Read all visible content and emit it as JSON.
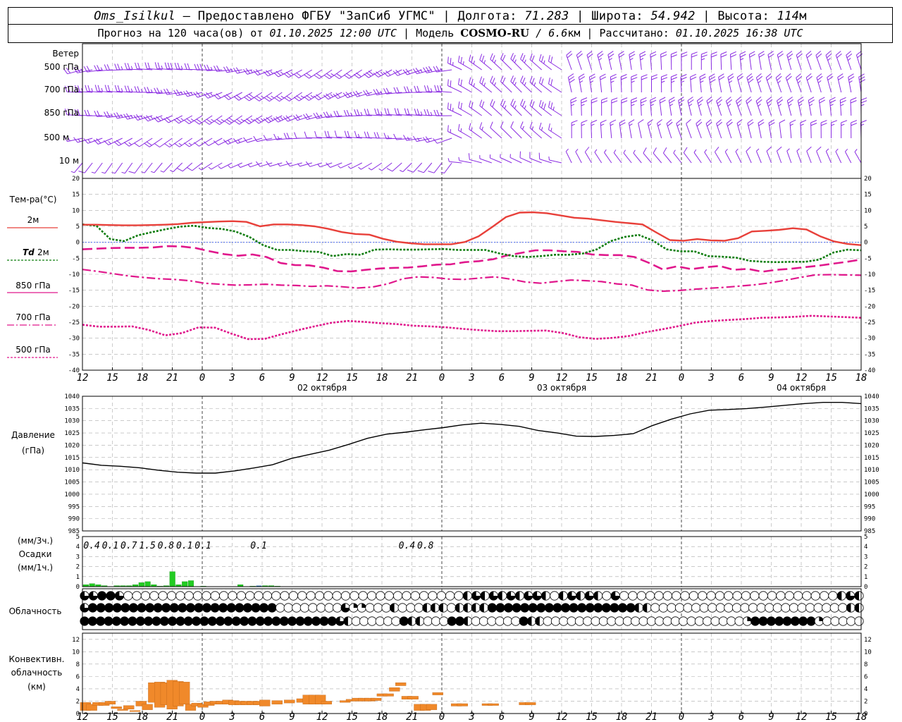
{
  "header": {
    "station": "Oms_Isilkul",
    "dash": "–",
    "provider": "Предоставлено ФГБУ \"ЗапСиб УГМС\"",
    "lon_label": "Долгота:",
    "lon": "71.283",
    "lat_label": "Широта:",
    "lat": "54.942",
    "alt_label": "Высота:",
    "alt": "114",
    "alt_unit": "м",
    "sep": "|",
    "forecast_prefix": "Прогноз на 120 часа(ов)",
    "from_word": "от",
    "forecast_time": "01.10.2025 12:00 UTC",
    "model_label": "Модель",
    "model_name": "COSMO-RU",
    "model_slash": "/",
    "model_res": "6.6",
    "model_unit": "км",
    "calc_label": "Рассчитано:",
    "calc_time": "01.10.2025 16:38 UTC"
  },
  "labels": {
    "wind": "Ветер",
    "wind_levels": [
      "500 гПа",
      "700 гПа",
      "850 гПа",
      "500 м",
      "10  м"
    ],
    "temp": "Тем-ра(°С)",
    "t2m": "2м",
    "td": "Td",
    "td2m": "2м",
    "t850": "850 гПа",
    "t700": "700 гПа",
    "t500": "500 гПа",
    "pressure1": "Давление",
    "pressure2": "(гПа)",
    "precip1": "(мм/3ч.)",
    "precip2": "Осадки",
    "precip3": "(мм/1ч.)",
    "cloud": "Облачность",
    "conv1": "Конвективн.",
    "conv2": "облачность",
    "conv3": "(км)"
  },
  "colors": {
    "t2m": "#e8403a",
    "td": "#0e7d0e",
    "t850": "#e0188c",
    "t700": "#e0188c",
    "t500": "#e0188c",
    "wind": "#8a2be2",
    "pressure": "#000000",
    "precip": "#22cc22",
    "precip_blue": "#1f6fb0",
    "conv": "#f0892a",
    "zero_line": "#3355ee",
    "grid": "#aaaaaa"
  },
  "chart_data": {
    "type": "meteogram",
    "time": {
      "hours_total": 126,
      "tick_labels": [
        "12",
        "15",
        "18",
        "21",
        "0",
        "3",
        "6",
        "9",
        "12",
        "15",
        "18",
        "21",
        "0",
        "3",
        "6",
        "9",
        "12",
        "15",
        "18",
        "21",
        "0",
        "3",
        "6",
        "9",
        "12",
        "15",
        "18"
      ],
      "date_labels": [
        {
          "text": "02 октября",
          "tick": 8
        },
        {
          "text": "03 октября",
          "tick": 16
        },
        {
          "text": "04 октября",
          "tick": 24
        }
      ],
      "midnight_ticks": [
        4,
        12,
        20
      ]
    },
    "temperature": {
      "ylim": [
        -40,
        20
      ],
      "yticks": [
        20,
        15,
        10,
        5,
        0,
        -5,
        -10,
        -15,
        -20,
        -25,
        -30,
        -35,
        -40
      ],
      "t2m": [
        5.5,
        5.5,
        5.4,
        5.3,
        5.3,
        5.4,
        5.5,
        5.7,
        6.1,
        6.3,
        6.5,
        6.6,
        6.4,
        5,
        5.6,
        5.6,
        5.4,
        5,
        4.2,
        3.2,
        2.6,
        2.4,
        1.1,
        0.2,
        -0.3,
        -0.6,
        -0.6,
        -0.6,
        0.1,
        1.9,
        4.8,
        7.9,
        9.3,
        9.4,
        9.1,
        8.4,
        7.7,
        7.4,
        6.9,
        6.4,
        6,
        5.6,
        3.1,
        0.7,
        0.5,
        1.0,
        0.6,
        0.5,
        1.3,
        3.4,
        3.6,
        3.9,
        4.4,
        4,
        1.9,
        0.3,
        -0.5,
        -0.9
      ],
      "td2m": [
        5.6,
        5.2,
        1,
        0.4,
        2.2,
        3.2,
        4.1,
        4.9,
        5.2,
        4.5,
        4.2,
        3.4,
        1.7,
        -0.9,
        -2.4,
        -2.4,
        -2.8,
        -3,
        -4.3,
        -3.7,
        -3.9,
        -2.3,
        -2.2,
        -2.3,
        -2.3,
        -2.2,
        -2.1,
        -2.4,
        -2.4,
        -2.4,
        -3.5,
        -4.3,
        -4.6,
        -4.3,
        -3.9,
        -3.9,
        -3.5,
        -2.2,
        0.4,
        1.7,
        2.3,
        0.6,
        -2.2,
        -2.8,
        -2.8,
        -4.3,
        -4.5,
        -4.8,
        -5.8,
        -6.1,
        -6.2,
        -6.1,
        -6.1,
        -5.4,
        -3.2,
        -2.3,
        -2.5
      ],
      "t850": [
        -2.2,
        -2,
        -1.8,
        -1.7,
        -1.7,
        -1.6,
        -1.2,
        -1.3,
        -1.8,
        -2.8,
        -3.7,
        -4.2,
        -3.8,
        -4.6,
        -6.5,
        -7.1,
        -7.2,
        -7.9,
        -9.0,
        -9.1,
        -8.6,
        -8.2,
        -8.0,
        -7.9,
        -7.5,
        -7.0,
        -6.9,
        -6.2,
        -5.9,
        -5.3,
        -4.1,
        -3.3,
        -2.5,
        -2.5,
        -2.8,
        -3,
        -3.8,
        -4,
        -4,
        -4.6,
        -6.4,
        -8.5,
        -7.5,
        -8.4,
        -7.8,
        -7.4,
        -8.6,
        -8.3,
        -9.2,
        -8.6,
        -8.3,
        -7.8,
        -7.3,
        -6.7,
        -6.1,
        -5.4
      ],
      "t700": [
        -8.5,
        -9.1,
        -9.8,
        -10.5,
        -11,
        -11.4,
        -11.6,
        -12,
        -12.8,
        -13.1,
        -13.4,
        -13.3,
        -13.1,
        -13.4,
        -13.5,
        -13.8,
        -13.6,
        -13.9,
        -14.3,
        -14.0,
        -13,
        -11.4,
        -10.8,
        -11,
        -11.5,
        -11.6,
        -11.2,
        -10.8,
        -11.5,
        -12.4,
        -12.8,
        -12.3,
        -11.8,
        -12.0,
        -12.3,
        -13,
        -13.4,
        -14.9,
        -15.3,
        -15.1,
        -14.7,
        -14.4,
        -14.1,
        -13.7,
        -13.3,
        -12.7,
        -11.9,
        -11,
        -10.2,
        -10.1,
        -10.2,
        -10.3
      ],
      "t500": [
        -25.8,
        -26.4,
        -26.4,
        -26.3,
        -27.4,
        -29.1,
        -28.4,
        -26.6,
        -26.7,
        -28.6,
        -30.3,
        -30.2,
        -28.8,
        -27.5,
        -26.3,
        -25.2,
        -24.6,
        -24.9,
        -25.3,
        -25.6,
        -26.1,
        -26.3,
        -26.6,
        -27.1,
        -27.5,
        -27.8,
        -27.8,
        -27.7,
        -27.6,
        -28.4,
        -29.7,
        -30.2,
        -29.9,
        -29.3,
        -28.1,
        -27.2,
        -26.2,
        -25.1,
        -24.6,
        -24.3,
        -24.0,
        -23.6,
        -23.5,
        -23.3,
        -23.0,
        -23.2,
        -23.4,
        -23.6
      ]
    },
    "pressure": {
      "ylim": [
        985,
        1040
      ],
      "yticks": [
        1040,
        1035,
        1030,
        1025,
        1020,
        1015,
        1010,
        1005,
        1000,
        995,
        990,
        985
      ],
      "values": [
        1012.8,
        1011.8,
        1011.4,
        1010.8,
        1009.8,
        1009,
        1008.6,
        1008.6,
        1009.5,
        1010.7,
        1012,
        1014.6,
        1016.3,
        1018,
        1020.3,
        1022.8,
        1024.5,
        1025.3,
        1026.3,
        1027.2,
        1028.3,
        1029,
        1028.5,
        1027.7,
        1026,
        1025,
        1023.7,
        1023.6,
        1024,
        1024.7,
        1028,
        1030.6,
        1032.8,
        1034.3,
        1034.6,
        1035,
        1035.6,
        1036.3,
        1037,
        1037.5,
        1037.5,
        1037
      ]
    },
    "precip": {
      "ylim": [
        0,
        5
      ],
      "yticks": [
        5,
        4,
        3,
        2,
        1,
        0
      ],
      "totals_3h": [
        {
          "h": 1.5,
          "text": "0.4"
        },
        {
          "h": 4.5,
          "text": "0.1"
        },
        {
          "h": 7.5,
          "text": "0.7"
        },
        {
          "h": 10.5,
          "text": "1.5"
        },
        {
          "h": 13.5,
          "text": "0.8"
        },
        {
          "h": 16.5,
          "text": "0.1"
        },
        {
          "h": 19.5,
          "text": "0.1"
        },
        {
          "h": 28.5,
          "text": "0.1"
        },
        {
          "h": 52.5,
          "text": "0.4"
        },
        {
          "h": 55.5,
          "text": "0.8"
        }
      ],
      "hourly": [
        0.2,
        0.3,
        0.2,
        0.1,
        0.0,
        0.1,
        0.1,
        0.1,
        0.2,
        0.4,
        0.5,
        0.2,
        0.05,
        0.1,
        1.5,
        0.2,
        0.5,
        0.6,
        0.0,
        0.05,
        0.0,
        0.0,
        0.0,
        0.0,
        0.0,
        0.2,
        0.0,
        0.05,
        0.0,
        0.1,
        0.1,
        0.05,
        0.0,
        0.0,
        0.0,
        0.0,
        0.0,
        0.0,
        0.0,
        0.0,
        0.0,
        0.0,
        0.0,
        0.0,
        0.0,
        0.0,
        0.0,
        0.0,
        0.0,
        0.0,
        0.0,
        0.0,
        0.0,
        0.0,
        0.0,
        0.0,
        0.0,
        0.0,
        0.0,
        0.0,
        0.0,
        0.0,
        0.0,
        0.0,
        0.0,
        0.0,
        0.0,
        0.0,
        0.0,
        0.0,
        0.0,
        0.0,
        0.0,
        0.0,
        0.0,
        0.0,
        0.0,
        0.0,
        0.0,
        0.0,
        0.0,
        0.0,
        0.0,
        0.0,
        0.0,
        0.0,
        0.0,
        0.0,
        0.0,
        0.0,
        0.0,
        0.0,
        0.0,
        0.0,
        0.0,
        0.0,
        0.0,
        0.0,
        0.0,
        0.0,
        0.0,
        0.0,
        0.0,
        0.0,
        0.0,
        0.0,
        0.0,
        0.0,
        0.0,
        0.0,
        0.0,
        0.0,
        0.0,
        0.0,
        0.0,
        0.0,
        0.0,
        0.0,
        0.0,
        0.0,
        0.0,
        0.0,
        0.0,
        0.0,
        0.0,
        0.0
      ],
      "hourly_blue": [
        {
          "h": 28,
          "v": 0.1
        }
      ]
    },
    "cloud_rows": [
      "▒▒●●▒000000000000000000000000000000000000000◐▒◐▒◐▒◐▒▒◐0◐▒◐▒◐0▒0000000000000000000000000◐▒◐",
      "▒●●●●●●●●●●●●●●●●●●●●●●●00000000▒◔◔000◐000◐◐◐0◐◐◐◐●●●●●●●●●●●●●●●●●●◐◐000000000000000000000000◐◐",
      "●●●●●●●●●●●●●●●●●●●●●●●●●●●●●●●●▒◐000000●◐◐000●●◐000000●◐◐0000000000000000000000000◔●●●●●●●●◔00000"
    ],
    "convective": {
      "ylim": [
        0,
        13
      ],
      "yticks": [
        12,
        10,
        8,
        6,
        4,
        2,
        0
      ],
      "bars": [
        {
          "h": 0.5,
          "b": 0.5,
          "t": 1.8
        },
        {
          "h": 1.5,
          "b": 0.5,
          "t": 1.5
        },
        {
          "h": 2.5,
          "b": 1.3,
          "t": 1.8
        },
        {
          "h": 3.5,
          "b": 1.3,
          "t": 1.8
        },
        {
          "h": 4.5,
          "b": 1.5,
          "t": 2.0
        },
        {
          "h": 5.5,
          "b": 0.8,
          "t": 1.1
        },
        {
          "h": 6.5,
          "b": 0.5,
          "t": 0.7
        },
        {
          "h": 7.5,
          "b": 0.7,
          "t": 1.3
        },
        {
          "h": 8.5,
          "b": 0.3,
          "t": 0.5
        },
        {
          "h": 9.5,
          "b": 1.2,
          "t": 2.0
        },
        {
          "h": 10.5,
          "b": 0.6,
          "t": 1.5
        },
        {
          "h": 11.5,
          "b": 1.8,
          "t": 5.0
        },
        {
          "h": 12.5,
          "b": 1.0,
          "t": 5.1
        },
        {
          "h": 13.5,
          "b": 1.4,
          "t": 5.0
        },
        {
          "h": 14.5,
          "b": 0.7,
          "t": 5.4
        },
        {
          "h": 15.5,
          "b": 1.2,
          "t": 5.2
        },
        {
          "h": 16.5,
          "b": 1.5,
          "t": 5.1
        },
        {
          "h": 17.5,
          "b": 0.5,
          "t": 1.5
        },
        {
          "h": 18.5,
          "b": 1.2,
          "t": 1.7
        },
        {
          "h": 19.5,
          "b": 1.0,
          "t": 1.5
        },
        {
          "h": 20.5,
          "b": 1.3,
          "t": 1.9
        },
        {
          "h": 21.5,
          "b": 1.5,
          "t": 2.0
        },
        {
          "h": 22.5,
          "b": 1.5,
          "t": 2.0
        },
        {
          "h": 23.5,
          "b": 1.5,
          "t": 2.2
        },
        {
          "h": 24.5,
          "b": 1.4,
          "t": 2.1
        },
        {
          "h": 25.5,
          "b": 1.4,
          "t": 2.0
        },
        {
          "h": 26.5,
          "b": 1.4,
          "t": 2.0
        },
        {
          "h": 27.5,
          "b": 1.4,
          "t": 2.0
        },
        {
          "h": 28.5,
          "b": 1.4,
          "t": 2.0
        },
        {
          "h": 29.5,
          "b": 1.2,
          "t": 2.2
        },
        {
          "h": 31.5,
          "b": 1.5,
          "t": 2.1
        },
        {
          "h": 33.5,
          "b": 1.7,
          "t": 2.2
        },
        {
          "h": 35.5,
          "b": 1.8,
          "t": 2.4
        },
        {
          "h": 36.5,
          "b": 1.5,
          "t": 3.0
        },
        {
          "h": 37.5,
          "b": 1.5,
          "t": 3.0
        },
        {
          "h": 38.5,
          "b": 1.5,
          "t": 3.0
        },
        {
          "h": 39.5,
          "b": 1.5,
          "t": 2.0
        },
        {
          "h": 42.5,
          "b": 1.8,
          "t": 2.1
        },
        {
          "h": 43.5,
          "b": 2.0,
          "t": 2.3
        },
        {
          "h": 44.5,
          "b": 2.0,
          "t": 2.5
        },
        {
          "h": 45.5,
          "b": 2.0,
          "t": 2.5
        },
        {
          "h": 46.5,
          "b": 2.0,
          "t": 2.5
        },
        {
          "h": 47.5,
          "b": 2.1,
          "t": 2.5
        },
        {
          "h": 48.5,
          "b": 2.8,
          "t": 3.2
        },
        {
          "h": 49.5,
          "b": 2.8,
          "t": 3.2
        },
        {
          "h": 50.5,
          "b": 3.6,
          "t": 4.2
        },
        {
          "h": 51.5,
          "b": 4.5,
          "t": 5.0
        },
        {
          "h": 52.5,
          "b": 2.3,
          "t": 2.8
        },
        {
          "h": 53.5,
          "b": 2.3,
          "t": 2.8
        },
        {
          "h": 54.5,
          "b": 0.5,
          "t": 1.5
        },
        {
          "h": 55.5,
          "b": 0.5,
          "t": 1.5
        },
        {
          "h": 56.5,
          "b": 0.6,
          "t": 1.5
        },
        {
          "h": 57.5,
          "b": 3.0,
          "t": 3.4
        },
        {
          "h": 60.5,
          "b": 1.2,
          "t": 1.6
        },
        {
          "h": 61.5,
          "b": 1.2,
          "t": 1.6
        },
        {
          "h": 65.5,
          "b": 1.3,
          "t": 1.6
        },
        {
          "h": 66.5,
          "b": 1.3,
          "t": 1.6
        },
        {
          "h": 71.5,
          "b": 1.4,
          "t": 1.8
        },
        {
          "h": 72.5,
          "b": 1.4,
          "t": 1.8
        }
      ]
    }
  }
}
